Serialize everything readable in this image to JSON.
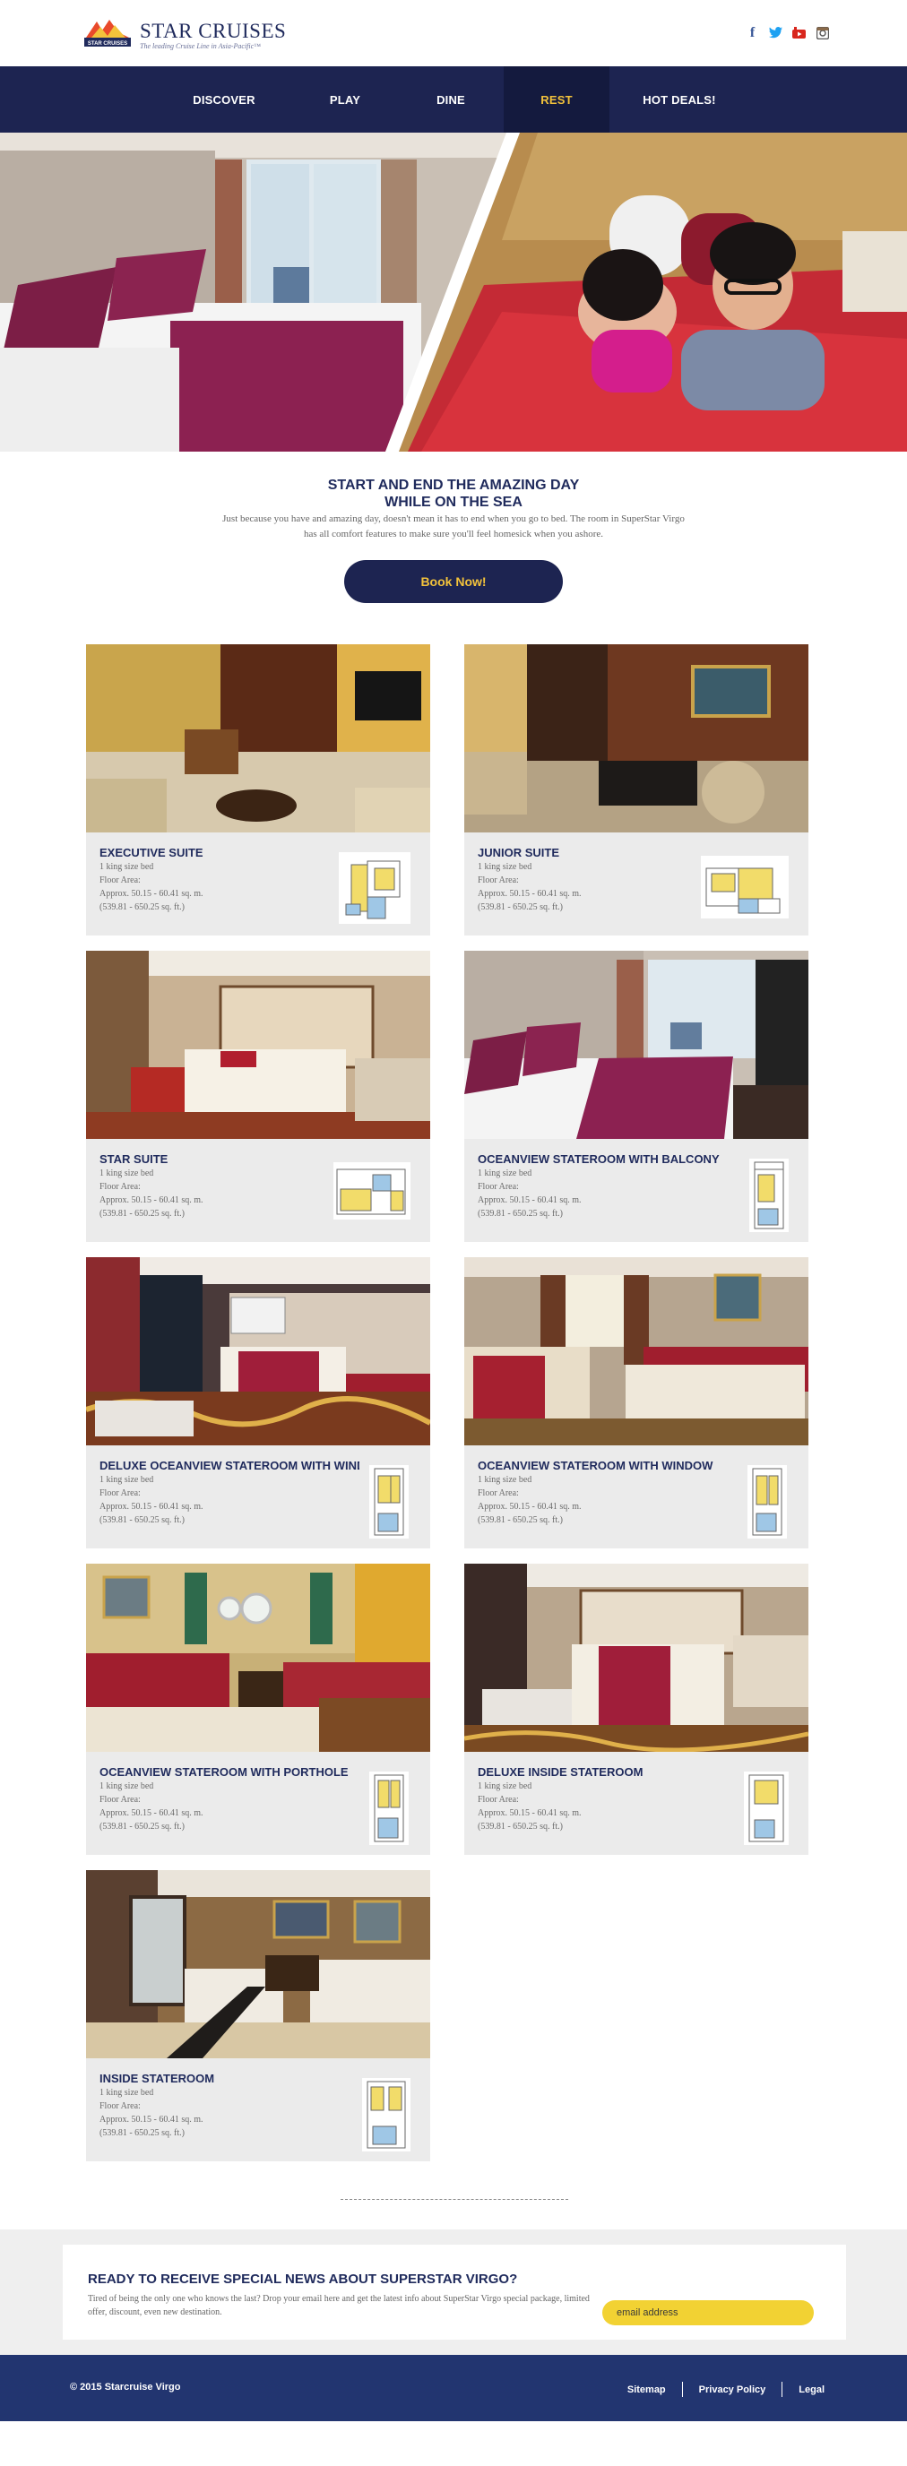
{
  "header": {
    "brand_name": "STAR CRUISES",
    "brand_tagline": "The leading Cruise Line in Asia-Pacific™",
    "logo_badge": "STAR CRUISES",
    "social": [
      {
        "icon": "facebook-icon",
        "glyph": "f",
        "color": "#3b5998"
      },
      {
        "icon": "twitter-icon",
        "glyph": "🐦",
        "color": "#1da1f2"
      },
      {
        "icon": "youtube-icon",
        "glyph": "▶",
        "color": "#d8261d"
      },
      {
        "icon": "instagram-icon",
        "glyph": "▣",
        "color": "#555555"
      }
    ]
  },
  "nav": {
    "items": [
      {
        "label": "DISCOVER"
      },
      {
        "label": "PLAY"
      },
      {
        "label": "DINE"
      },
      {
        "label": "REST",
        "active": true
      },
      {
        "label": "HOT DEALS!"
      }
    ]
  },
  "intro": {
    "title_line1": "START AND END THE AMAZING DAY",
    "title_line2": "WHILE ON THE SEA",
    "text": "Just because you have and amazing day, doesn't mean it has to end when you go to bed. The room in SuperStar Virgo has all comfort features to make sure you'll feel homesick when you ashore.",
    "button": "Book Now!"
  },
  "rooms": [
    {
      "title": "EXECUTIVE SUITE",
      "bed": "1 king size bed",
      "area_label": "Floor Area:",
      "area_m": "Approx. 50.15 - 60.41 sq. m.",
      "area_ft": "(539.81 - 650.25 sq. ft.)"
    },
    {
      "title": "JUNIOR SUITE",
      "bed": "1 king size bed",
      "area_label": "Floor Area:",
      "area_m": "Approx. 50.15 - 60.41 sq. m.",
      "area_ft": "(539.81 - 650.25 sq. ft.)"
    },
    {
      "title": "STAR SUITE",
      "bed": "1 king size bed",
      "area_label": "Floor Area:",
      "area_m": "Approx. 50.15 - 60.41 sq. m.",
      "area_ft": "(539.81 - 650.25 sq. ft.)"
    },
    {
      "title": "OCEANVIEW STATEROOM WITH BALCONY",
      "bed": "1 king size bed",
      "area_label": "Floor Area:",
      "area_m": "Approx. 50.15 - 60.41 sq. m.",
      "area_ft": "(539.81 - 650.25 sq. ft.)"
    },
    {
      "title": "DELUXE OCEANVIEW STATEROOM WITH WINDOW",
      "bed": "1 king size bed",
      "area_label": "Floor Area:",
      "area_m": "Approx. 50.15 - 60.41 sq. m.",
      "area_ft": "(539.81 - 650.25 sq. ft.)"
    },
    {
      "title": "OCEANVIEW STATEROOM WITH WINDOW",
      "bed": "1 king size bed",
      "area_label": "Floor Area:",
      "area_m": "Approx. 50.15 - 60.41 sq. m.",
      "area_ft": "(539.81 - 650.25 sq. ft.)"
    },
    {
      "title": "OCEANVIEW STATEROOM WITH PORTHOLE",
      "bed": "1 king size bed",
      "area_label": "Floor Area:",
      "area_m": "Approx. 50.15 - 60.41 sq. m.",
      "area_ft": "(539.81 - 650.25 sq. ft.)"
    },
    {
      "title": "DELUXE INSIDE STATEROOM",
      "bed": "1 king size bed",
      "area_label": "Floor Area:",
      "area_m": "Approx. 50.15 - 60.41 sq. m.",
      "area_ft": "(539.81 - 650.25 sq. ft.)"
    },
    {
      "title": "INSIDE STATEROOM",
      "bed": "1 king size bed",
      "area_label": "Floor Area:",
      "area_m": "Approx. 50.15 - 60.41 sq. m.",
      "area_ft": "(539.81 - 650.25 sq. ft.)"
    }
  ],
  "newsletter": {
    "title": "READY TO RECEIVE SPECIAL NEWS ABOUT SUPERSTAR VIRGO?",
    "text": "Tired of being the only one who knows the last? Drop your email here and get the latest info about SuperStar Virgo special package, limited offer, discount, even new destination.",
    "placeholder": "email address"
  },
  "footer": {
    "copyright": "© 2015 Starcruise Virgo",
    "links": [
      "Sitemap",
      "Privacy Policy",
      "Legal"
    ]
  },
  "colors": {
    "navy": "#1d2451",
    "accent_yellow": "#f2c23b",
    "footer_blue": "#223570",
    "card_bg": "#ebebeb"
  }
}
